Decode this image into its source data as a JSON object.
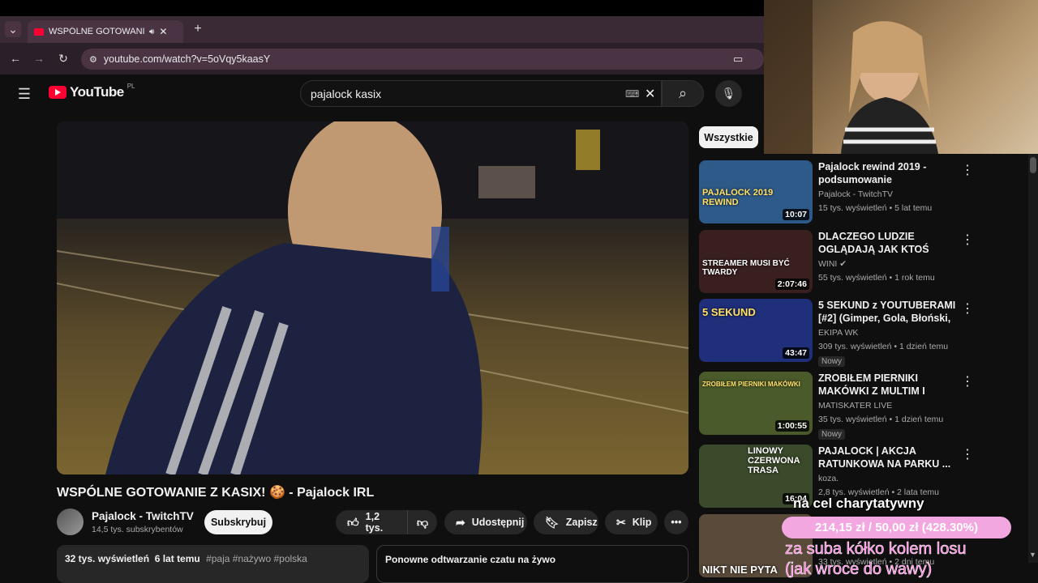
{
  "browser": {
    "tab_title": "WSPÓLNE GOTOWANIE Z K",
    "url": "youtube.com/watch?v=5oVqy5kaasY"
  },
  "masthead": {
    "logo_text": "YouTube",
    "region": "PL",
    "search_value": "pajalock kasix"
  },
  "video": {
    "title": "WSPÓLNE GOTOWANIE Z KASIX! 🍪 - Pajalock IRL",
    "channel": "Pajalock - TwitchTV",
    "subscribers": "14,5 tys. subskrybentów",
    "subscribe_label": "Subskrybuj",
    "likes": "1,2 tys.",
    "share_label": "Udostępnij",
    "save_label": "Zapisz",
    "clip_label": "Klip",
    "views_date": "32 tys. wyświetleń  6 lat temu",
    "hashtags": "#paja #nażywo #polska",
    "chat_replay": "Ponowne odtwarzanie czatu na żywo"
  },
  "sidebar": {
    "chip": "Wszystkie",
    "items": [
      {
        "title": "Pajalock rewind 2019 - podsumowanie",
        "channel": "Pajalock - TwitchTV",
        "meta": "15 tys. wyświetleń • 5 lat temu",
        "duration": "10:07",
        "thumb_text": "PAJALOCK 2019 REWIND",
        "badge": "",
        "thumb_color": "#2e5a8a"
      },
      {
        "title": "DLACZEGO LUDZIE OGLĄDAJĄ JAK KTOŚ GRA? O ...",
        "channel": "WINI ✔",
        "meta": "55 tys. wyświetleń • 1 rok temu",
        "duration": "2:07:46",
        "thumb_text": "STREAMER MUSI BYĆ TWARDY",
        "badge": "",
        "thumb_color": "#3a1f1f"
      },
      {
        "title": "5 SEKUND z YOUTUBERAMI [#2] (Gimper, Gola, Błoński, ...",
        "channel": "EKIPA WK",
        "meta": "309 tys. wyświetleń • 1 dzień temu",
        "duration": "43:47",
        "thumb_text": "5 SEKUND",
        "badge": "Nowy",
        "thumb_color": "#1f2f7a"
      },
      {
        "title": "ZROBIŁEM PIERNIKI MAKÓWKI Z MULTIM I ZWIERZAKIEM! ...",
        "channel": "MATISKATER LIVE",
        "meta": "35 tys. wyświetleń • 1 dzień temu",
        "duration": "1:00:55",
        "thumb_text": "ZROBIŁEM PIERNIKI MAKÓWKI",
        "badge": "Nowy",
        "thumb_color": "#4a5a2a"
      },
      {
        "title": "PAJALOCK | AKCJA RATUNKOWA NA PARKU ...",
        "channel": "koza.",
        "meta": "2,8 tys. wyświetleń • 2 lata temu",
        "duration": "16:04",
        "thumb_text": "PARK LINOWY CZERWONA TRASA",
        "badge": "",
        "thumb_color": "#3a4a2a"
      },
      {
        "title": "",
        "channel": "",
        "meta": "33 tys. wyświetleń • 2 dni temu",
        "duration": "",
        "thumb_text": "NIKT NIE PYTA",
        "badge": "",
        "thumb_color": "#5a4a3a"
      }
    ]
  },
  "overlay": {
    "goal_label": "na cel charytatywny",
    "goal_progress": "214,15 zł / 50,00 zł (428.30%)",
    "line1": "za suba kółko kolem losu",
    "line2": "(jak wroce do wawy)"
  },
  "colors": {
    "accent": "#ff0033",
    "overlay_pink": "#ff5fd6",
    "goal_bar": "#f2a7e0"
  }
}
